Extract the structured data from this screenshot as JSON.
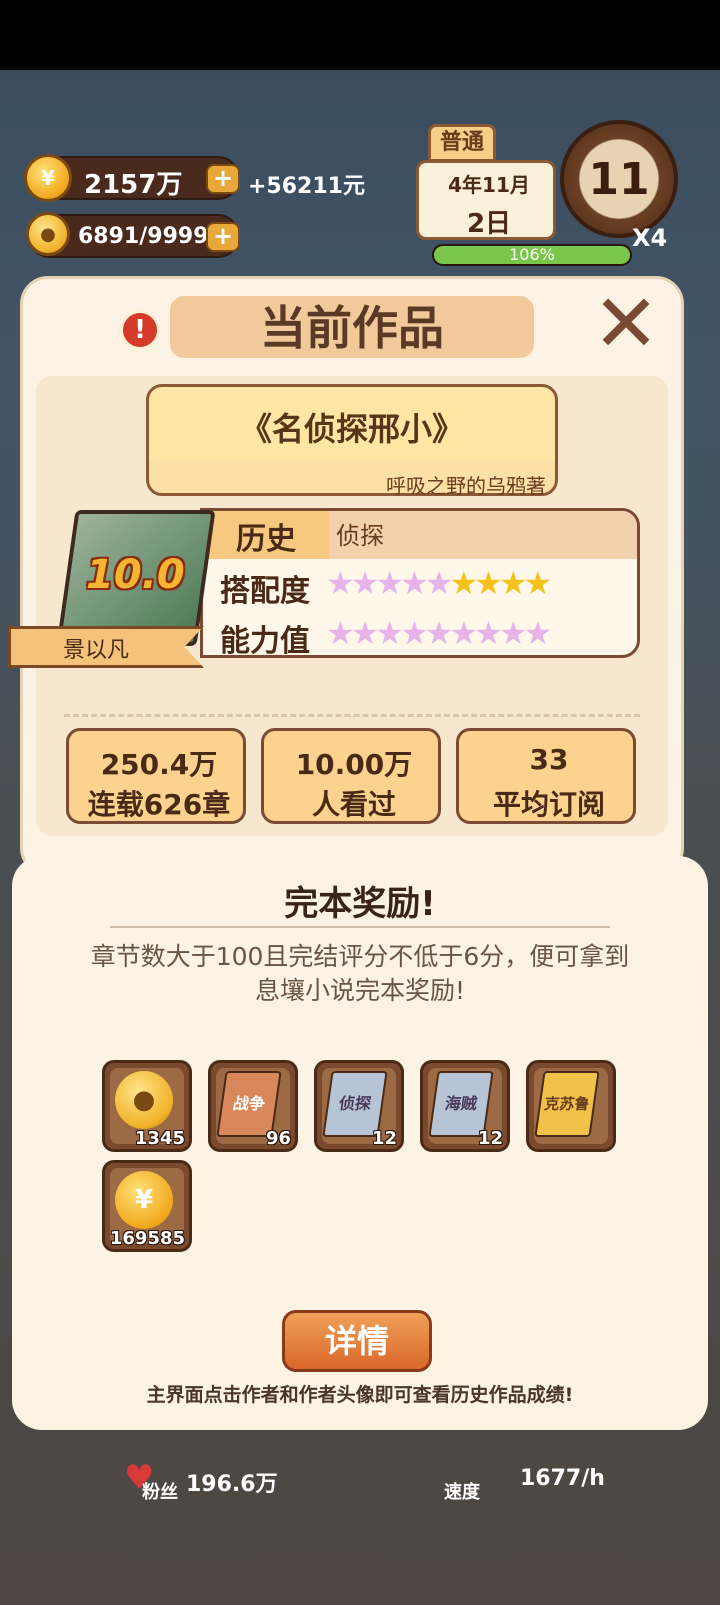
{
  "hud": {
    "coins": "2157万",
    "income": "+56211元",
    "inspiration": "6891/9999",
    "mode": "普通",
    "date_month": "4年11月",
    "date_day": "2日",
    "clock_hour": "11",
    "speed": "X4",
    "energy_percent": "106%",
    "energy_fill": 1.0
  },
  "panel": {
    "title": "当前作品",
    "book_title": "《名侦探邢小》",
    "author_line": "呼吸之野的乌鸦著",
    "score": "10.0",
    "author_name": "景以凡",
    "genre_label": "历史",
    "genre_value": "侦探",
    "match_label": "搭配度",
    "match_stars": {
      "total": 9,
      "gold": 4
    },
    "ability_label": "能力值",
    "ability_stars": {
      "total": 9,
      "gold": 0
    },
    "stats": [
      {
        "value": "250.4万",
        "caption": "连载626章"
      },
      {
        "value": "10.00万",
        "caption": "人看过"
      },
      {
        "value": "33",
        "caption": "平均订阅"
      }
    ]
  },
  "reward": {
    "title": "完本奖励!",
    "description": "章节数大于100且完结评分不低于6分，便可拿到息壤小说完本奖励!",
    "items": [
      {
        "name": "inspiration-bulb",
        "label": "",
        "count": "1345"
      },
      {
        "name": "war-book",
        "label": "战争",
        "count": "96"
      },
      {
        "name": "detective-book",
        "label": "侦探",
        "count": "12"
      },
      {
        "name": "pirate-book",
        "label": "海贼",
        "count": "12"
      },
      {
        "name": "cthulhu-book",
        "label": "克苏鲁",
        "count": ""
      },
      {
        "name": "coin",
        "label": "",
        "count": "169585"
      }
    ],
    "details_label": "详情",
    "hint": "主界面点击作者和作者头像即可查看历史作品成绩!"
  },
  "bottom": {
    "fans_label": "粉丝",
    "fans_value": "196.6万",
    "speed_label": "速度",
    "speed_value": "1677/h"
  },
  "colors": {
    "panel_bg": "#fdf3e4",
    "accent_orange": "#d8672a",
    "brown": "#7a4a35",
    "star_gold": "#f4c21a",
    "star_pastel": "#e7b4ea"
  }
}
